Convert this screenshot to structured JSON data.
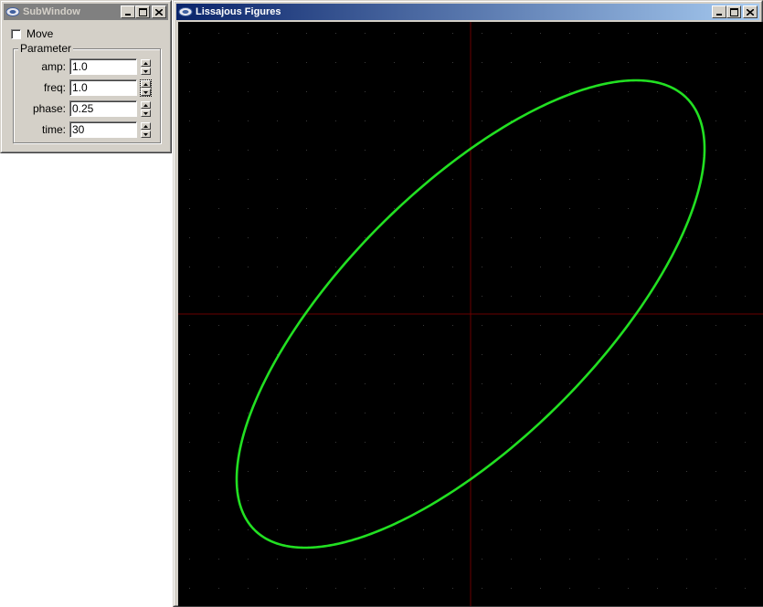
{
  "subwindow": {
    "title": "SubWindow",
    "move_label": "Move",
    "group_label": "Parameter",
    "params": [
      {
        "label": "amp:",
        "value": "1.0"
      },
      {
        "label": "freq:",
        "value": "1.0"
      },
      {
        "label": "phase:",
        "value": "0.25"
      },
      {
        "label": "time:",
        "value": "30"
      }
    ]
  },
  "main_window": {
    "title": "Lissajous Figures"
  },
  "colors": {
    "curve": "#22e022",
    "axes": "#6a0000",
    "grid_dots": "#3a3a3a",
    "background": "#000000"
  },
  "icons": [
    "app-icon",
    "minimize-icon",
    "maximize-icon",
    "close-icon",
    "spin-up-icon",
    "spin-down-icon"
  ]
}
